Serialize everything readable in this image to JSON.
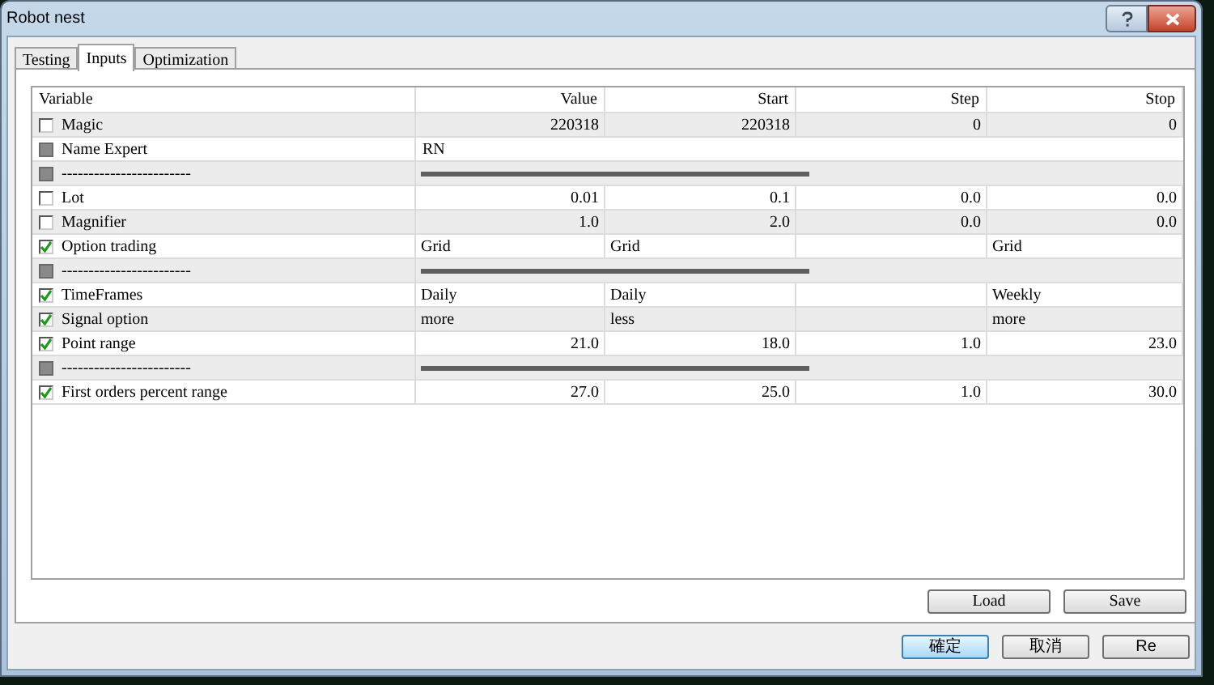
{
  "window": {
    "title": "Robot nest"
  },
  "tabs": [
    {
      "label": "Testing",
      "selected": false
    },
    {
      "label": "Inputs",
      "selected": true
    },
    {
      "label": "Optimization",
      "selected": false
    }
  ],
  "table": {
    "columns": [
      "Variable",
      "Value",
      "Start",
      "Step",
      "Stop"
    ],
    "rows": [
      {
        "kind": "number",
        "label": "Magic",
        "checked": false,
        "disabled": false,
        "cells": [
          "220318",
          "220318",
          "0",
          "0"
        ]
      },
      {
        "kind": "string",
        "label": "Name Expert",
        "checked": false,
        "disabled": true,
        "cells": [
          "RN"
        ]
      },
      {
        "kind": "separator",
        "label": "------------------------",
        "checked": false,
        "disabled": true
      },
      {
        "kind": "number",
        "label": "Lot",
        "checked": false,
        "disabled": false,
        "cells": [
          "0.01",
          "0.1",
          "0.0",
          "0.0"
        ]
      },
      {
        "kind": "number",
        "label": "Magnifier",
        "checked": false,
        "disabled": false,
        "cells": [
          "1.0",
          "2.0",
          "0.0",
          "0.0"
        ]
      },
      {
        "kind": "text",
        "label": "Option trading",
        "checked": true,
        "disabled": false,
        "cells": [
          "Grid",
          "Grid",
          null,
          "Grid"
        ]
      },
      {
        "kind": "separator",
        "label": "------------------------",
        "checked": false,
        "disabled": true
      },
      {
        "kind": "text",
        "label": "TimeFrames",
        "checked": true,
        "disabled": false,
        "cells": [
          "Daily",
          "Daily",
          null,
          "Weekly"
        ]
      },
      {
        "kind": "text",
        "label": "Signal option",
        "checked": true,
        "disabled": false,
        "cells": [
          "more",
          "less",
          null,
          "more"
        ]
      },
      {
        "kind": "number",
        "label": "Point range",
        "checked": true,
        "disabled": false,
        "cells": [
          "21.0",
          "18.0",
          "1.0",
          "23.0"
        ]
      },
      {
        "kind": "separator",
        "label": "------------------------",
        "checked": false,
        "disabled": true
      },
      {
        "kind": "number",
        "label": "First orders percent range",
        "checked": true,
        "disabled": false,
        "cells": [
          "27.0",
          "25.0",
          "1.0",
          "30.0"
        ]
      }
    ]
  },
  "panel_buttons": [
    "Load",
    "Save"
  ],
  "dialog_buttons": [
    {
      "label": "確定",
      "default": true
    },
    {
      "label": "取消",
      "default": false
    },
    {
      "label": "Re",
      "default": false
    }
  ]
}
